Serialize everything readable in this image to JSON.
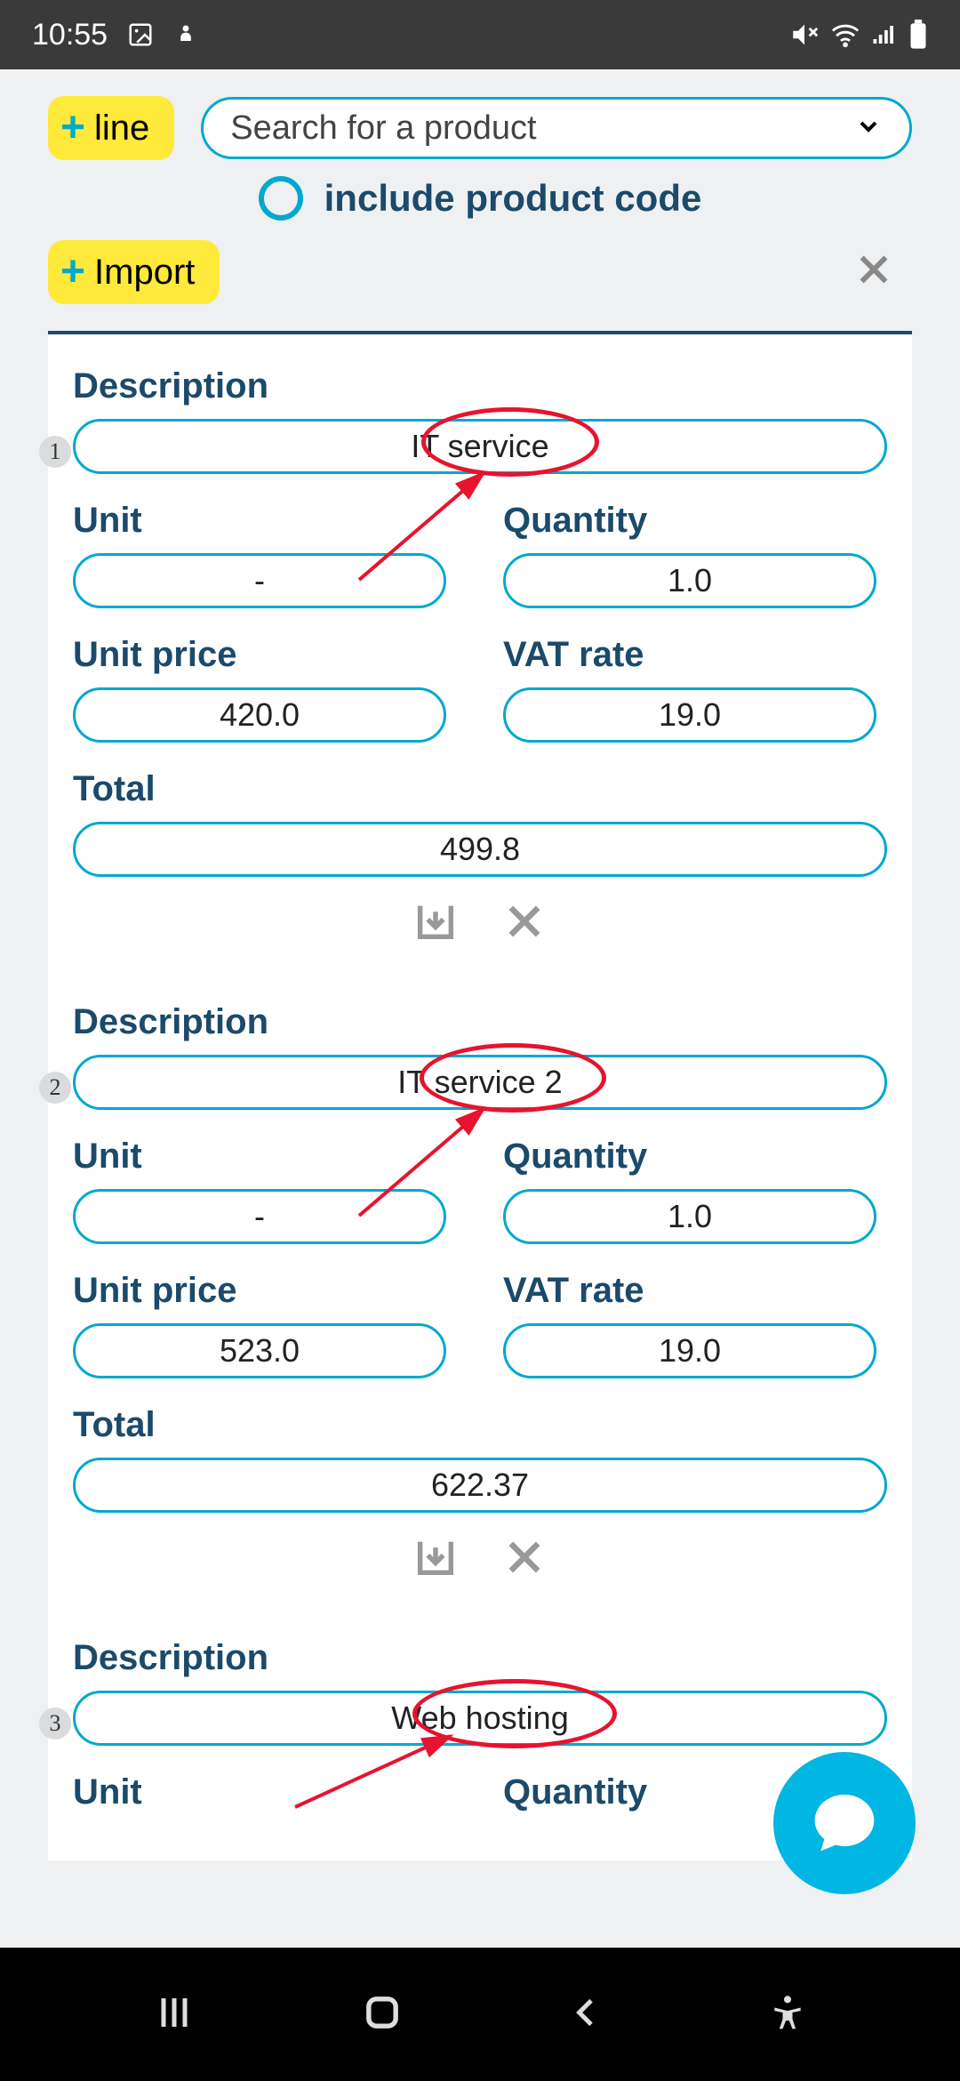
{
  "status": {
    "time": "10:55"
  },
  "toolbar": {
    "add_line_label": "line",
    "search_placeholder": "Search for a product",
    "include_label": "include product code",
    "import_label": "Import"
  },
  "labels": {
    "description": "Description",
    "unit": "Unit",
    "quantity": "Quantity",
    "unit_price": "Unit price",
    "vat_rate": "VAT rate",
    "total": "Total"
  },
  "items": [
    {
      "num": "1",
      "description": "IT service",
      "unit": "-",
      "quantity": "1.0",
      "unit_price": "420.0",
      "vat_rate": "19.0",
      "total": "499.8"
    },
    {
      "num": "2",
      "description": "IT service 2",
      "unit": "-",
      "quantity": "1.0",
      "unit_price": "523.0",
      "vat_rate": "19.0",
      "total": "622.37"
    },
    {
      "num": "3",
      "description": "Web hosting",
      "unit": "",
      "quantity": "",
      "unit_price": "",
      "vat_rate": "",
      "total": ""
    }
  ],
  "colors": {
    "accent": "#00a9ce",
    "label": "#1b4a6b",
    "yellow": "#ffe93b",
    "annotation": "#e7132f"
  }
}
